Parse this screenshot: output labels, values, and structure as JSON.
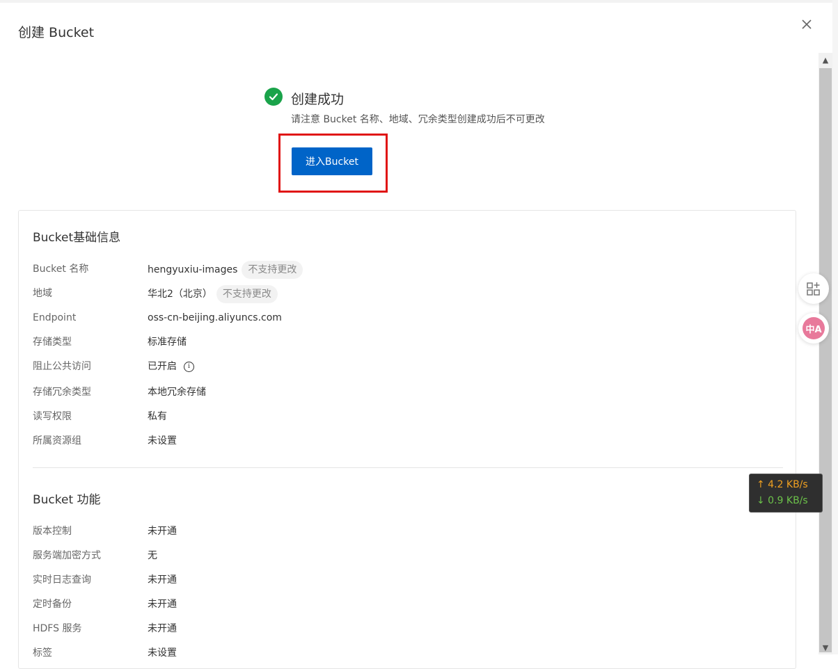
{
  "dialog": {
    "title": "创建 Bucket",
    "close_icon": "close-icon"
  },
  "success": {
    "title": "创建成功",
    "note": "请注意 Bucket 名称、地域、冗余类型创建成功后不可更改",
    "button_label": "进入Bucket"
  },
  "basic": {
    "title": "Bucket基础信息",
    "rows": [
      {
        "label": "Bucket 名称",
        "value": "hengyuxiu-images",
        "tag": "不支持更改"
      },
      {
        "label": "地域",
        "value": "华北2（北京）",
        "tag": "不支持更改"
      },
      {
        "label": "Endpoint",
        "value": "oss-cn-beijing.aliyuncs.com"
      },
      {
        "label": "存储类型",
        "value": "标准存储"
      },
      {
        "label": "阻止公共访问",
        "value": "已开启",
        "info_icon": "i"
      },
      {
        "label": "存储冗余类型",
        "value": "本地冗余存储"
      },
      {
        "label": "读写权限",
        "value": "私有"
      },
      {
        "label": "所属资源组",
        "value": "未设置"
      }
    ]
  },
  "features": {
    "title": "Bucket 功能",
    "rows": [
      {
        "label": "版本控制",
        "value": "未开通"
      },
      {
        "label": "服务端加密方式",
        "value": "无"
      },
      {
        "label": "实时日志查询",
        "value": "未开通"
      },
      {
        "label": "定时备份",
        "value": "未开通"
      },
      {
        "label": "HDFS 服务",
        "value": "未开通"
      },
      {
        "label": "标签",
        "value": "未设置"
      }
    ]
  },
  "side": {
    "translate_badge": "中A"
  },
  "netspeed": {
    "up": "↑ 4.2 KB/s",
    "down": "↓ 0.9 KB/s"
  },
  "colors": {
    "primary": "#0064c8",
    "success": "#1aa34a",
    "highlight": "#e01414"
  }
}
